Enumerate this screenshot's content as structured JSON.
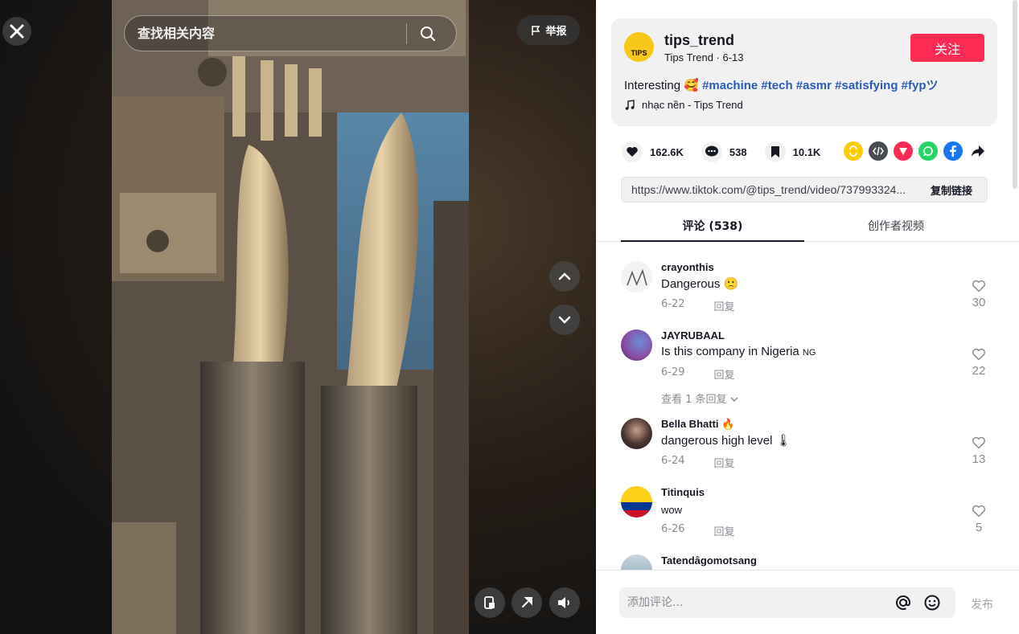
{
  "colors": {
    "accent": "#fe2c55",
    "hashtag": "#2b5db9"
  },
  "search": {
    "placeholder": "查找相关内容"
  },
  "video": {
    "report_label": "举报"
  },
  "author": {
    "username": "tips_trend",
    "subtitle": "Tips Trend · 6-13",
    "avatar_text": "TIPS",
    "follow_label": "关注",
    "caption_text": "Interesting 🥰 ",
    "hashtags": "#machine #tech #asmr #satisfying #fypツ",
    "music": "nhạc nền - Tips Trend"
  },
  "stats": {
    "likes": "162.6K",
    "comments": "538",
    "saves": "10.1K"
  },
  "share_icons": [
    "repost-icon",
    "embed-icon",
    "send-icon",
    "whatsapp-icon",
    "facebook-icon",
    "share-arrow-icon"
  ],
  "link": {
    "url": "https://www.tiktok.com/@tips_trend/video/737993324...",
    "copy_label": "复制链接"
  },
  "tabs": {
    "comments": "评论 (538)",
    "creator_videos": "创作者视频"
  },
  "comments": [
    {
      "user": "crayonthis",
      "text": "Dangerous 🙁",
      "date": "6-22",
      "reply": "回复",
      "likes": "30"
    },
    {
      "user": "JAYRUBAAL",
      "text": "Is this company in Nigeria",
      "flag": "NG",
      "date": "6-29",
      "reply": "回复",
      "likes": "22",
      "more": "查看 1 条回复"
    },
    {
      "user": "Bella Bhatti 🔥",
      "text": "dangerous high level 🌡",
      "date": "6-24",
      "reply": "回复",
      "likes": "13"
    },
    {
      "user": "Titinquis",
      "text": "wow",
      "date": "6-26",
      "reply": "回复",
      "likes": "5"
    },
    {
      "user": "Tatendâgomotsang"
    }
  ],
  "comment_bar": {
    "placeholder": "添加评论...",
    "post_label": "发布"
  }
}
